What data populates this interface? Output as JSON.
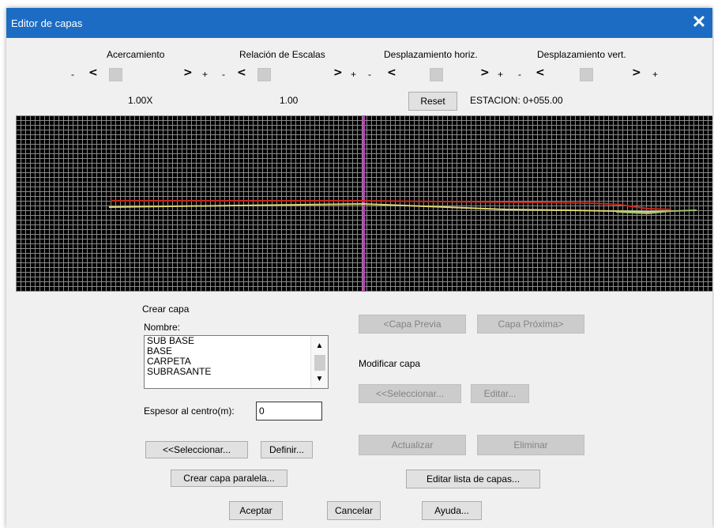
{
  "window": {
    "title": "Editor de capas",
    "close_label": "✕"
  },
  "controls": {
    "zoom": {
      "label": "Acercamiento",
      "minus": "-",
      "plus": "+",
      "left": "<",
      "right": ">",
      "value": "1.00X"
    },
    "scale": {
      "label": "Relación de Escalas",
      "minus": "-",
      "plus": "+",
      "left": "<",
      "right": ">",
      "value": "1.00"
    },
    "hshift": {
      "label": "Desplazamiento horiz.",
      "minus": "-",
      "plus": "+",
      "left": "<",
      "right": ">"
    },
    "vshift": {
      "label": "Desplazamiento vert.",
      "minus": "-",
      "plus": "+",
      "left": "<",
      "right": ">"
    },
    "reset_label": "Reset",
    "station": "ESTACION:  0+055.00"
  },
  "canvas": {
    "background": "#000000",
    "grid_color": "#8c8c8c",
    "center_line_color": "#c040c0",
    "layer_colors": [
      "#c8281e",
      "#e0d470",
      "#9fbf6f"
    ]
  },
  "crear_capa": {
    "heading": "Crear capa",
    "nombre_label": "Nombre:",
    "layers": [
      "SUB BASE",
      "BASE",
      "CARPETA",
      "SUBRASANTE"
    ],
    "scroll_up": "▲",
    "scroll_down": "▼",
    "espesor_label": "Espesor al centro(m):",
    "espesor_value": "0",
    "select_label": "<<Seleccionar...",
    "define_label": "Definir...",
    "parallel_label": "Crear capa paralela..."
  },
  "nav": {
    "prev_label": "<Capa Previa",
    "next_label": "Capa Próxima>"
  },
  "modificar": {
    "heading": "Modificar capa",
    "select_label": "<<Seleccionar...",
    "edit_label": "Editar...",
    "update_label": "Actualizar",
    "delete_label": "Eliminar",
    "edit_list_label": "Editar lista de capas..."
  },
  "footer": {
    "accept_label": "Aceptar",
    "cancel_label": "Cancelar",
    "help_label": "Ayuda..."
  }
}
